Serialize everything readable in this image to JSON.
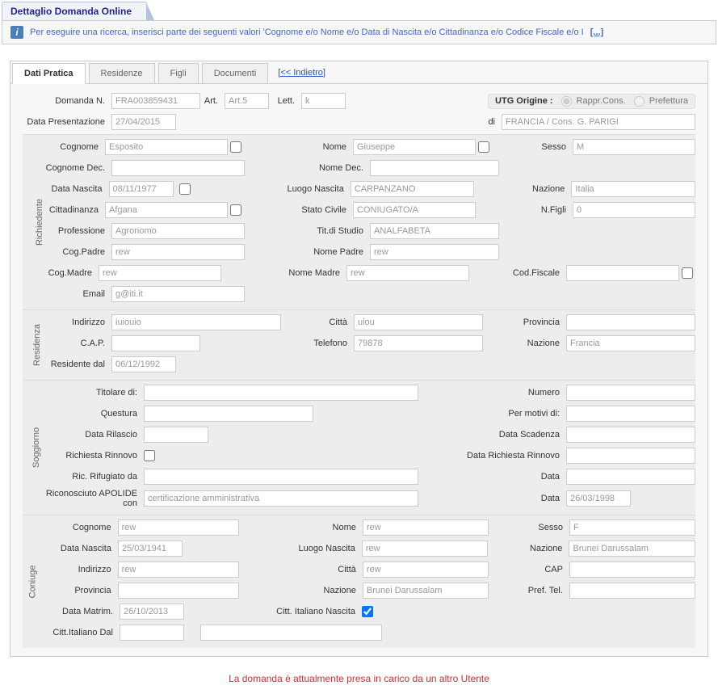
{
  "header": {
    "title": "Dettaglio Domanda Online"
  },
  "info": {
    "text": "Per eseguire una ricerca, inserisci parte dei seguenti valori 'Cognome e/o Nome e/o Data di Nascita e/o Cittadinanza e/o Codice Fiscale e/o I",
    "more": "[...]"
  },
  "tabs": {
    "items": [
      "Dati Pratica",
      "Residenze",
      "Figli",
      "Documenti"
    ],
    "back": "[<< Indietro]"
  },
  "labels": {
    "domanda_n": "Domanda N.",
    "art": "Art.",
    "lett": "Lett.",
    "utg": "UTG Origine :",
    "rappr": "Rappr.Cons.",
    "pref": "Prefettura",
    "data_pres": "Data Presentazione",
    "di": "di",
    "cognome": "Cognome",
    "nome": "Nome",
    "sesso": "Sesso",
    "cognome_dec": "Cognome Dec.",
    "nome_dec": "Nome Dec.",
    "data_nascita": "Data Nascita",
    "luogo_nascita": "Luogo Nascita",
    "nazione": "Nazione",
    "cittadinanza": "Cittadinanza",
    "stato_civile": "Stato Civile",
    "n_figli": "N.Figli",
    "professione": "Professione",
    "tit_studio": "Tit.di Studio",
    "cog_padre": "Cog.Padre",
    "nome_padre": "Nome Padre",
    "cog_madre": "Cog.Madre",
    "nome_madre": "Nome Madre",
    "cod_fiscale": "Cod.Fiscale",
    "email": "Email",
    "indirizzo": "Indirizzo",
    "citta": "Città",
    "provincia": "Provincia",
    "cap": "C.A.P.",
    "telefono": "Telefono",
    "residente_dal": "Residente dal",
    "titolare_di": "Titolare di:",
    "numero": "Numero",
    "questura": "Questura",
    "per_motivi": "Per motivi di:",
    "data_rilascio": "Data Rilascio",
    "data_scadenza": "Data Scadenza",
    "richiesta_rinnovo": "Richiesta Rinnovo",
    "data_rich_rinnovo": "Data Richiesta Rinnovo",
    "ric_rifugiato": "Ric. Rifugiato da",
    "data": "Data",
    "apolide": "Riconosciuto APOLIDE con",
    "cap2": "CAP",
    "pref_tel": "Pref. Tel.",
    "data_matrim": "Data Matrim.",
    "citt_it_nascita": "Citt. Italiano Nascita",
    "citt_it_dal": "Citt.Italiano Dal",
    "sec_richiedente": "Richiedente",
    "sec_residenza": "Residenza",
    "sec_soggiorno": "Soggiorno",
    "sec_coniuge": "Coniuge"
  },
  "values": {
    "domanda_n": "FRA003859431",
    "art": "Art.5",
    "lett": "k",
    "data_pres": "27/04/2015",
    "di": "FRANCIA / Cons. G. PARIGI",
    "cognome": "Esposito",
    "nome": "Giuseppe",
    "sesso": "M",
    "data_nascita": "08/11/1977",
    "luogo_nascita": "CARPANZANO",
    "nazione": "Italia",
    "cittadinanza": "Afgana",
    "stato_civile": "CONIUGATO/A",
    "n_figli": "0",
    "professione": "Agronomo",
    "tit_studio": "ANALFABETA",
    "cog_padre": "rew",
    "nome_padre": "rew",
    "cog_madre": "rew",
    "nome_madre": "rew",
    "email": "g@iti.it",
    "indirizzo": "iuiouio",
    "citta": "uiou",
    "telefono": "79878",
    "res_nazione": "Francia",
    "residente_dal": "06/12/1992",
    "apolide": "certificazione amministrativa",
    "apolide_data": "26/03/1998",
    "con_cognome": "rew",
    "con_nome": "rew",
    "con_sesso": "F",
    "con_data_nascita": "25/03/1941",
    "con_luogo_nascita": "rew",
    "con_nazione": "Brunei Darussalam",
    "con_indirizzo": "rew",
    "con_citta": "rew",
    "con_nazione2": "Brunei Darussalam",
    "data_matrim": "26/10/2013"
  },
  "status": "La domanda è attualmente presa in carico da un altro Utente"
}
